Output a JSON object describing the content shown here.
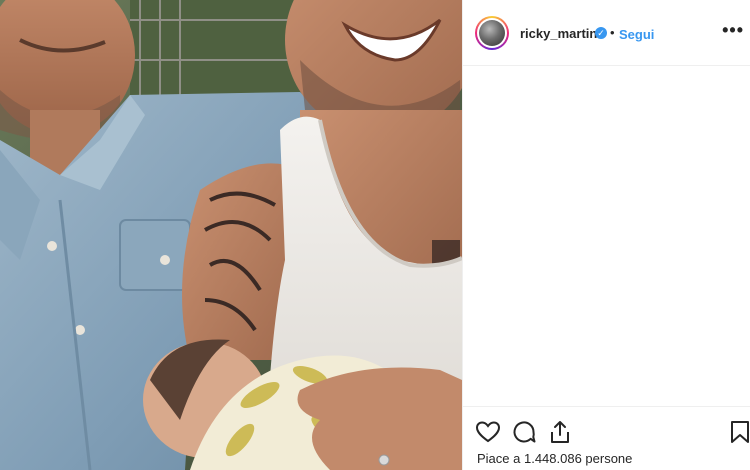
{
  "post": {
    "username": "ricky_martin",
    "separator": "•",
    "follow_label": "Segui",
    "more_icon": "more-options-icon",
    "more_label": "•••",
    "verified_icon": "verified-badge-icon"
  },
  "actions": {
    "icons": [
      "heart-icon",
      "comment-icon",
      "share-icon",
      "bookmark-icon"
    ],
    "likes_text": "Piace a 1.448.086 persone"
  },
  "colors": {
    "accent": "#3897f0",
    "text": "#262626",
    "divider": "#efefef"
  }
}
